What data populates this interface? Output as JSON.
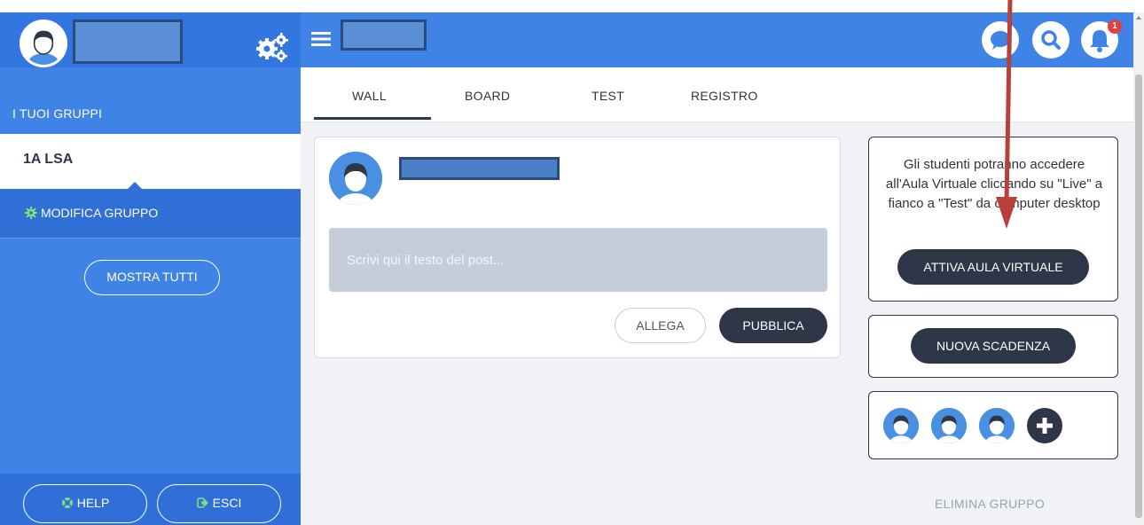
{
  "sidebar": {
    "groups_label": "I TUOI GRUPPI",
    "active_group": "1A LSA",
    "modify_group_label": "MODIFICA GRUPPO",
    "show_all_label": "MOSTRA TUTTI",
    "help_label": "HELP",
    "exit_label": "ESCI"
  },
  "topbar": {
    "notification_count": "1"
  },
  "tabs": [
    {
      "label": "WALL",
      "active": true
    },
    {
      "label": "BOARD",
      "active": false
    },
    {
      "label": "TEST",
      "active": false
    },
    {
      "label": "REGISTRO",
      "active": false
    }
  ],
  "post": {
    "placeholder": "Scrivi qui il testo del post...",
    "attach_label": "ALLEGA",
    "publish_label": "PUBBLICA"
  },
  "virtual_classroom": {
    "info_text": "Gli studenti potranno accedere all'Aula Virtuale cliccando su \"Live\" a fianco a \"Test\" da computer desktop",
    "activate_label": "ATTIVA AULA VIRTUALE"
  },
  "deadline": {
    "new_label": "NUOVA SCADENZA"
  },
  "delete_group_label": "ELIMINA GRUPPO",
  "colors": {
    "brand_blue": "#3f83e6",
    "dark_button": "#2d3748",
    "notification_red": "#e53e3e",
    "annotation_arrow": "#b5413a"
  }
}
